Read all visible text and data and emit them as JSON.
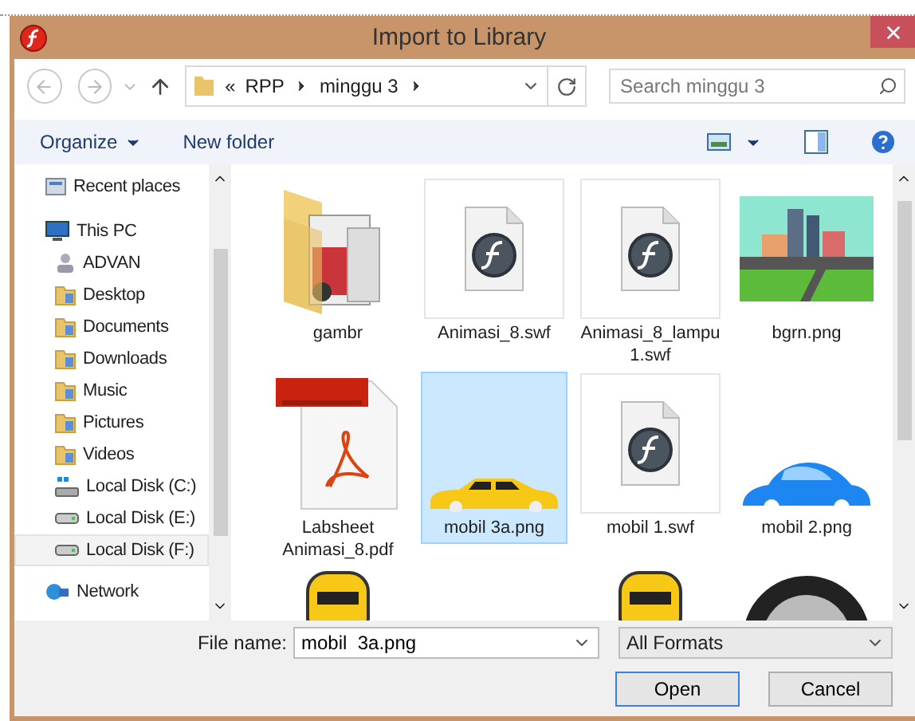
{
  "window": {
    "title": "Import to Library"
  },
  "nav": {
    "path": [
      "«",
      "RPP",
      "minggu 3"
    ],
    "search": {
      "placeholder": "Search minggu 3"
    }
  },
  "toolbar": {
    "organize": "Organize",
    "new_folder": "New folder"
  },
  "sidebar": {
    "items": [
      {
        "label": "Recent places",
        "kind": "recent",
        "selected": false
      },
      {
        "label": "This PC",
        "kind": "pc",
        "selected": false,
        "children": [
          {
            "label": "ADVAN",
            "kind": "user",
            "selected": false
          },
          {
            "label": "Desktop",
            "kind": "folder",
            "selected": false
          },
          {
            "label": "Documents",
            "kind": "folder",
            "selected": false
          },
          {
            "label": "Downloads",
            "kind": "folder",
            "selected": false
          },
          {
            "label": "Music",
            "kind": "folder",
            "selected": false
          },
          {
            "label": "Pictures",
            "kind": "folder",
            "selected": false
          },
          {
            "label": "Videos",
            "kind": "folder",
            "selected": false
          },
          {
            "label": "Local Disk (C:)",
            "kind": "system-disk",
            "selected": false
          },
          {
            "label": "Local Disk (E:)",
            "kind": "disk",
            "selected": false
          },
          {
            "label": "Local Disk (F:)",
            "kind": "disk",
            "selected": true
          }
        ]
      },
      {
        "label": "Network",
        "kind": "network",
        "selected": false
      }
    ]
  },
  "files": [
    {
      "name": "gambr",
      "kind": "folder",
      "selected": false
    },
    {
      "name": "Animasi_8.swf",
      "kind": "flash",
      "selected": false
    },
    {
      "name": "Animasi_8_lampu 1.swf",
      "kind": "flash",
      "selected": false
    },
    {
      "name": "bgrn.png",
      "kind": "city-image",
      "selected": false
    },
    {
      "name": "Labsheet Animasi_8.pdf",
      "kind": "pdf",
      "selected": false
    },
    {
      "name": "mobil  3a.png",
      "kind": "side-car-image",
      "selected": true
    },
    {
      "name": "mobil 1.swf",
      "kind": "flash",
      "selected": false
    },
    {
      "name": "mobil 2.png",
      "kind": "beetle-image",
      "selected": false
    },
    {
      "kind": "top-car-image",
      "selected": false
    },
    {
      "kind": "unseen"
    },
    {
      "kind": "top-car-image",
      "selected": false
    },
    {
      "kind": "wheel-image",
      "selected": false
    }
  ],
  "footer": {
    "file_name": {
      "label": "File name:",
      "value": "mobil  3a.png"
    },
    "format": {
      "value": "All Formats"
    },
    "buttons": [
      {
        "label": "Open",
        "default": true
      },
      {
        "label": "Cancel",
        "default": false
      }
    ]
  }
}
